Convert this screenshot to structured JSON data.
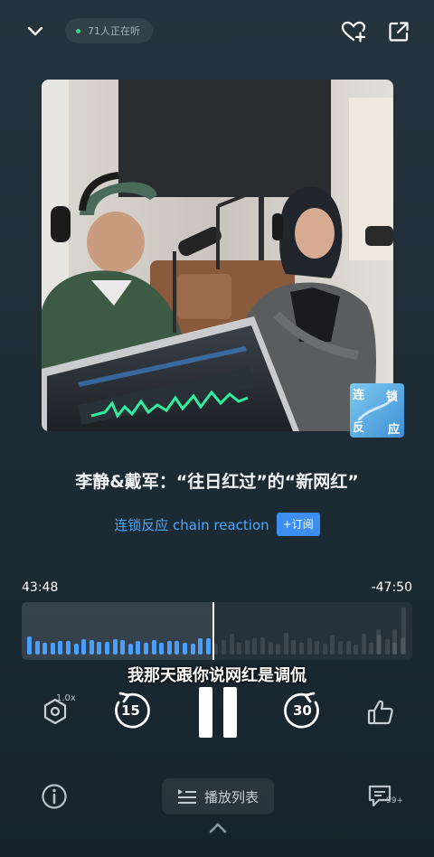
{
  "header": {
    "listeners_text": "71人正在听"
  },
  "episode": {
    "title": "李静&戴军：“往日红过”的“新网红”",
    "channel_name": "连锁反应 chain reaction",
    "subscribe_label": "+订阅",
    "cover_badge": [
      "连",
      "锁",
      "反",
      "应"
    ]
  },
  "player": {
    "elapsed": "43:48",
    "remaining": "-47:50",
    "progress_fraction": 0.48,
    "subtitle": "我那天跟你说网红是调侃",
    "speed": "1.0x",
    "rewind_seconds": "15",
    "forward_seconds": "30",
    "playlist_label": "播放列表",
    "comment_count": "99+"
  },
  "colors": {
    "accent": "#4aa8ff",
    "subscribe_bg": "#3d8ef0",
    "wave_played": "#4a9fff",
    "online_dot": "#3fd38a"
  },
  "icons": {
    "collapse": "chevron-down-icon",
    "favorite": "heart-plus-icon",
    "share": "share-icon",
    "speed": "hexagon-speed-icon",
    "rewind": "rewind-15-icon",
    "pause": "pause-icon",
    "forward": "forward-30-icon",
    "like": "thumbs-up-icon",
    "info": "info-icon",
    "playlist": "playlist-icon",
    "comments": "comment-icon",
    "expand": "chevron-up-icon"
  }
}
